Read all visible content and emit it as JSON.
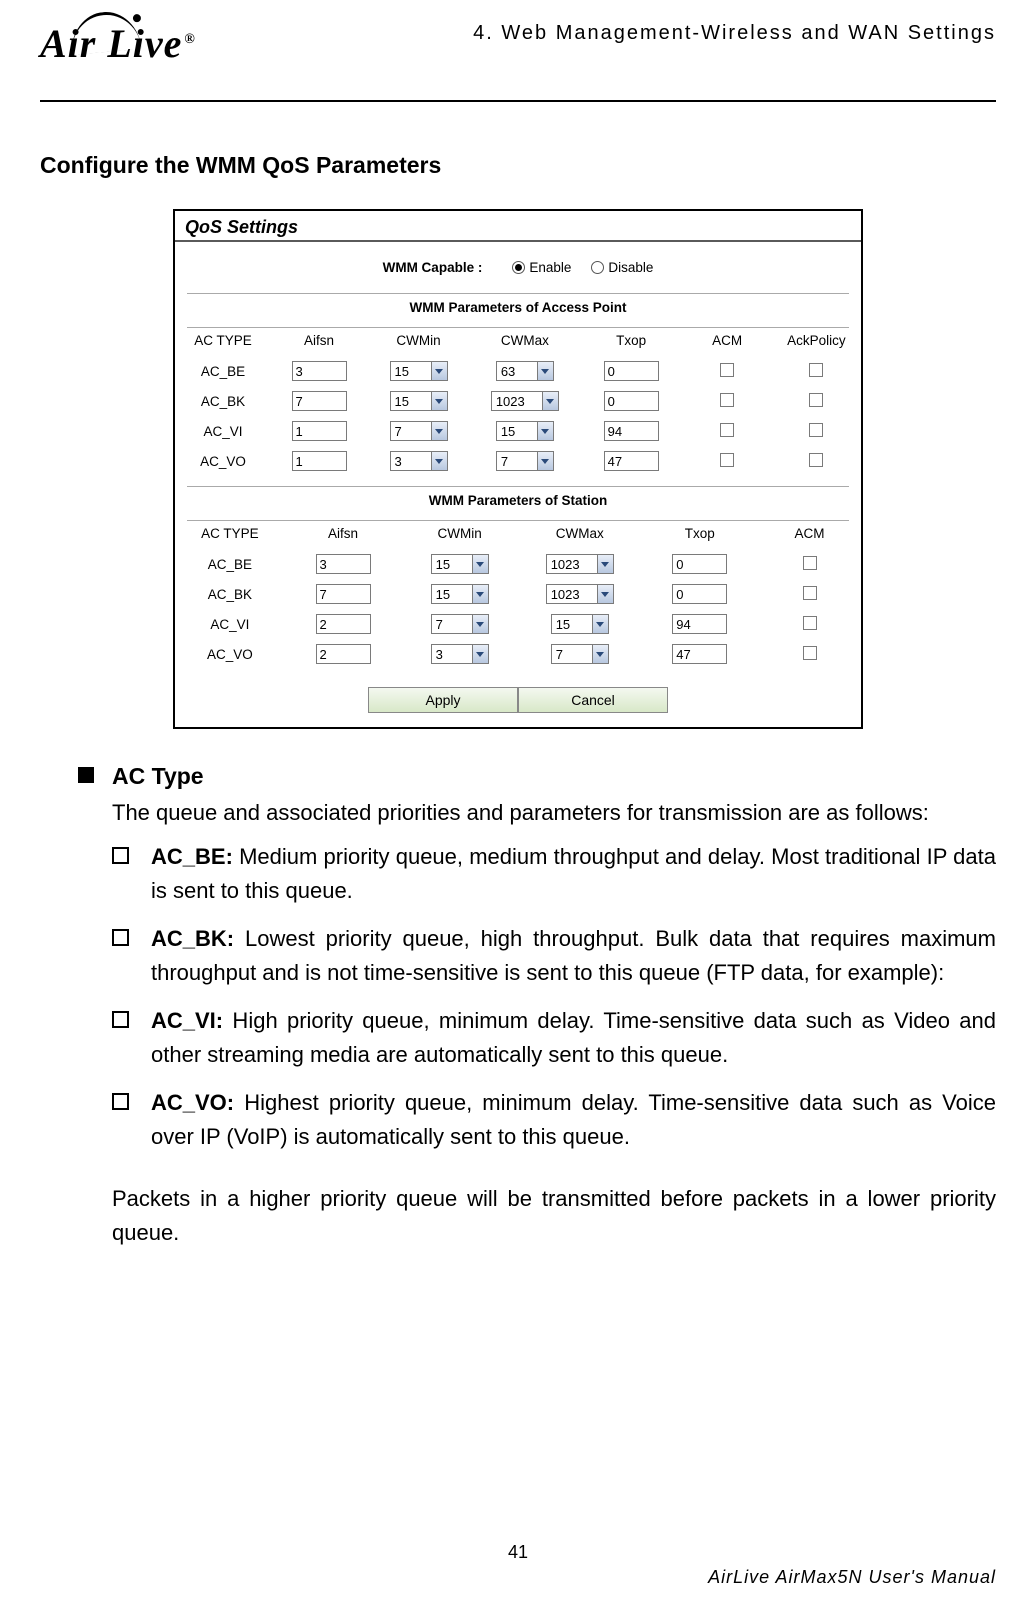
{
  "header": {
    "logo_text": "Air Live",
    "chapter": "4. Web Management-Wireless and WAN Settings"
  },
  "section_title": "Configure the WMM QoS Parameters",
  "figure": {
    "qos_title": "QoS Settings",
    "wmm_capable_label": "WMM Capable :",
    "enable": "Enable",
    "disable": "Disable",
    "ap_subtitle": "WMM Parameters of Access Point",
    "sta_subtitle": "WMM Parameters of Station",
    "headers_ap": [
      "AC TYPE",
      "Aifsn",
      "CWMin",
      "CWMax",
      "Txop",
      "ACM",
      "AckPolicy"
    ],
    "headers_sta": [
      "AC TYPE",
      "Aifsn",
      "CWMin",
      "CWMax",
      "Txop",
      "ACM"
    ],
    "ap_rows": [
      {
        "type": "AC_BE",
        "aifsn": "3",
        "cwmin": "15",
        "cwmax": "63",
        "txop": "0"
      },
      {
        "type": "AC_BK",
        "aifsn": "7",
        "cwmin": "15",
        "cwmax": "1023",
        "txop": "0"
      },
      {
        "type": "AC_VI",
        "aifsn": "1",
        "cwmin": "7",
        "cwmax": "15",
        "txop": "94"
      },
      {
        "type": "AC_VO",
        "aifsn": "1",
        "cwmin": "3",
        "cwmax": "7",
        "txop": "47"
      }
    ],
    "sta_rows": [
      {
        "type": "AC_BE",
        "aifsn": "3",
        "cwmin": "15",
        "cwmax": "1023",
        "txop": "0"
      },
      {
        "type": "AC_BK",
        "aifsn": "7",
        "cwmin": "15",
        "cwmax": "1023",
        "txop": "0"
      },
      {
        "type": "AC_VI",
        "aifsn": "2",
        "cwmin": "7",
        "cwmax": "15",
        "txop": "94"
      },
      {
        "type": "AC_VO",
        "aifsn": "2",
        "cwmin": "3",
        "cwmax": "7",
        "txop": "47"
      }
    ],
    "apply": "Apply",
    "cancel": "Cancel"
  },
  "body": {
    "bullet_title": "AC Type",
    "intro": "The queue and associated priorities and parameters for transmission are as follows:",
    "items": [
      {
        "label": "AC_BE:",
        "text": " Medium priority queue, medium throughput and delay. Most traditional IP data is sent to this queue."
      },
      {
        "label": "AC_BK:",
        "text": " Lowest priority queue, high throughput. Bulk data that requires maximum throughput and is not time-sensitive is sent to this queue (FTP data, for example):"
      },
      {
        "label": "AC_VI:",
        "text": " High priority queue, minimum delay. Time-sensitive data such as Video and other streaming media are automatically sent to this queue."
      },
      {
        "label": "AC_VO:",
        "text": " Highest priority queue, minimum delay. Time-sensitive data such as Voice over IP (VoIP) is automatically sent to this queue."
      }
    ],
    "closing": "Packets in a higher priority queue will be transmitted before packets in a lower priority queue."
  },
  "footer": {
    "page": "41",
    "manual": "AirLive AirMax5N User's Manual"
  }
}
